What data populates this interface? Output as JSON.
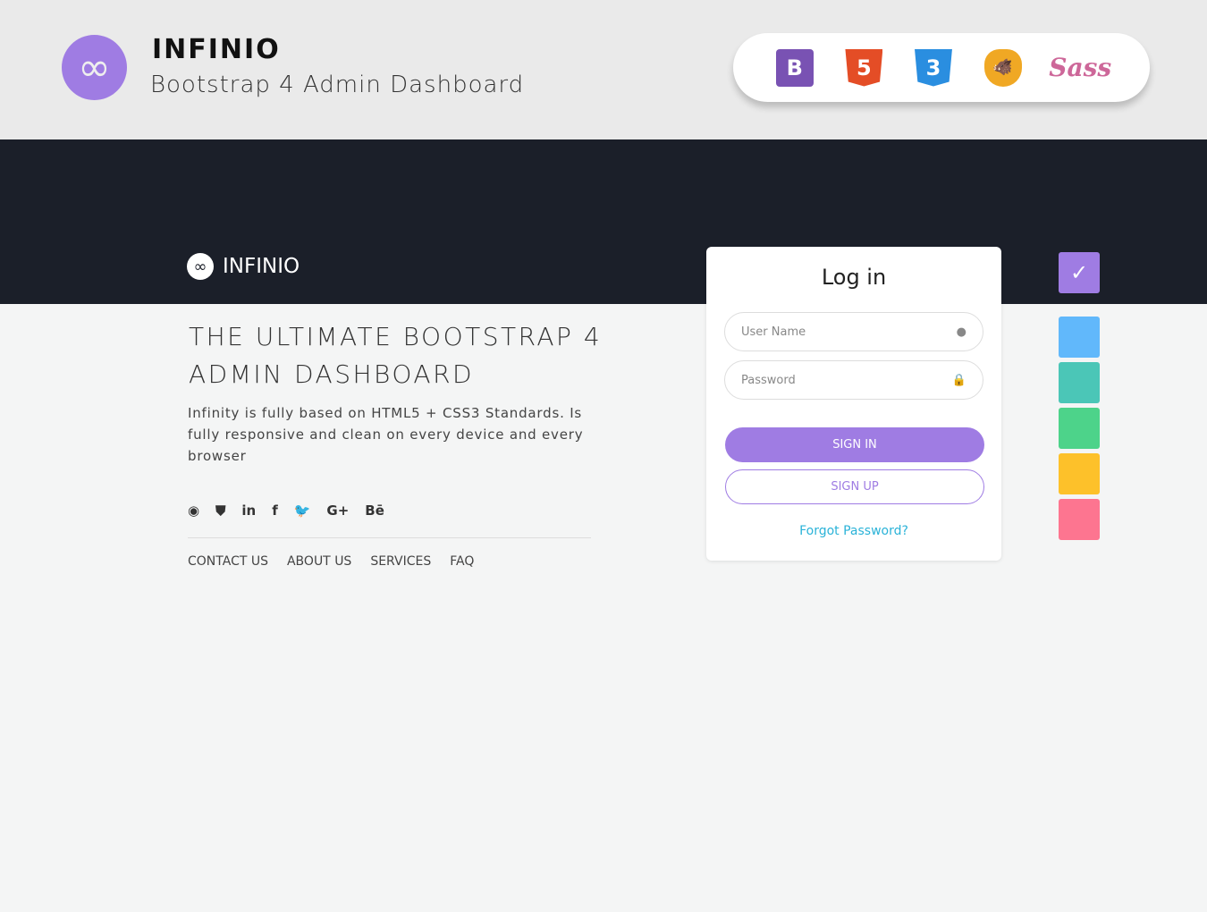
{
  "header": {
    "brand": "INFINIO",
    "subtitle": "Bootstrap 4 Admin Dashboard",
    "logo_icon": "infinity-icon",
    "tech": [
      "B",
      "5",
      "3",
      "🐗",
      "Sass"
    ]
  },
  "hero": {
    "brand": "INFINIO",
    "title": "THE ULTIMATE BOOTSTRAP 4 ADMIN DASHBOARD",
    "description": "Infinity is fully based on HTML5 + CSS3 Standards. Is fully responsive and clean on every device and every browser",
    "social": [
      "◉",
      "⛊",
      "in",
      "f",
      "🐦",
      "G+",
      "Bē"
    ],
    "links": [
      "CONTACT US",
      "ABOUT US",
      "SERVICES",
      "FAQ"
    ]
  },
  "login": {
    "title": "Log in",
    "username_placeholder": "User Name",
    "password_placeholder": "Password",
    "sign_in": "SIGN IN",
    "sign_up": "SIGN UP",
    "forgot": "Forgot Password?"
  },
  "swatches": {
    "check": "✓",
    "colors": [
      "#9f7ce3",
      "#61b8fb",
      "#4bc6b7",
      "#4dd38a",
      "#fdc12a",
      "#fd7590"
    ]
  }
}
